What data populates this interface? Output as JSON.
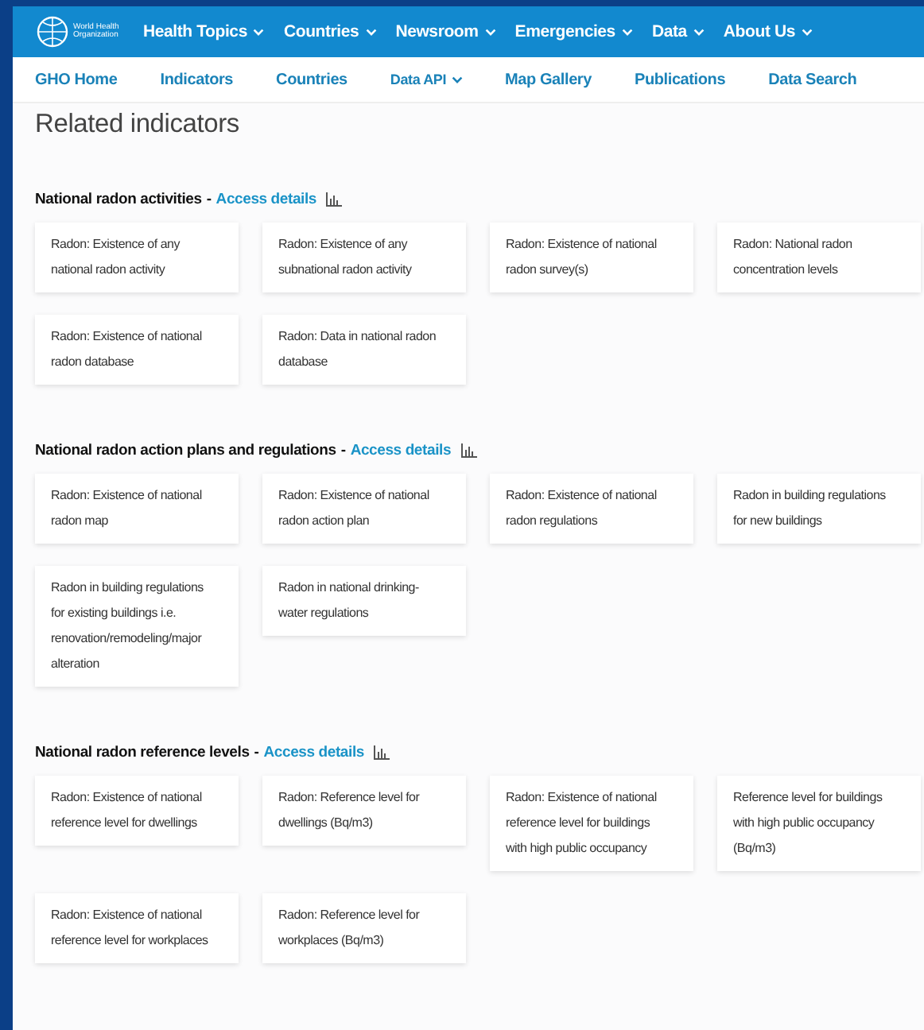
{
  "header": {
    "logo_text": "World Health Organization",
    "nav": [
      {
        "label": "Health Topics",
        "has_menu": true
      },
      {
        "label": "Countries",
        "has_menu": true
      },
      {
        "label": "Newsroom",
        "has_menu": true
      },
      {
        "label": "Emergencies",
        "has_menu": true
      },
      {
        "label": "Data",
        "has_menu": true
      },
      {
        "label": "About Us",
        "has_menu": true
      }
    ]
  },
  "subnav": [
    {
      "label": "GHO Home",
      "has_menu": false
    },
    {
      "label": "Indicators",
      "has_menu": false
    },
    {
      "label": "Countries",
      "has_menu": false
    },
    {
      "label": "Data API",
      "has_menu": true
    },
    {
      "label": "Map Gallery",
      "has_menu": false
    },
    {
      "label": "Publications",
      "has_menu": false
    },
    {
      "label": "Data Search",
      "has_menu": false
    }
  ],
  "page_title": "Related indicators",
  "sections": [
    {
      "title": "National radon activities",
      "separator": "-",
      "link": "Access details",
      "indicators": [
        "Radon: Existence of any national radon activity",
        "Radon: Existence of any subnational radon activity",
        "Radon: Existence of national radon survey(s)",
        "Radon: National radon concentration levels",
        "Radon: Existence of national radon database",
        "Radon: Data in national radon database"
      ]
    },
    {
      "title": "National radon action plans and regulations",
      "separator": "-",
      "link": "Access details",
      "indicators": [
        "Radon: Existence of national radon map",
        "Radon: Existence of national radon action plan",
        "Radon: Existence of national radon regulations",
        "Radon in building regulations for new buildings",
        "Radon in building regulations for existing buildings i.e. renovation/remodeling/major alteration",
        "Radon in national drinking-water regulations"
      ]
    },
    {
      "title": "National radon reference levels",
      "separator": "-",
      "link": "Access details",
      "indicators": [
        "Radon: Existence of national reference level for dwellings",
        "Radon: Reference level for dwellings (Bq/m3)",
        "Radon: Existence of national reference level for buildings with high public occupancy",
        "Reference level for buildings with high public occupancy (Bq/m3)",
        "Radon: Existence of national reference level for workplaces",
        "Radon: Reference level for workplaces (Bq/m3)"
      ]
    }
  ]
}
